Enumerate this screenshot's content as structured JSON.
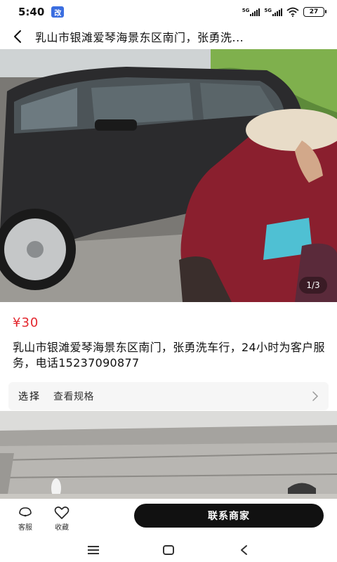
{
  "status_bar": {
    "time": "5:40",
    "app_icon_text": "改",
    "network_1": "5G",
    "network_2": "5G",
    "battery": "27"
  },
  "header": {
    "title": "乳山市银滩爱琴海景东区南门，张勇洗..."
  },
  "gallery": {
    "counter": "1/3"
  },
  "product": {
    "price": "¥30",
    "description": "乳山市银滩爱琴海景东区南门，张勇洗车行，24小时为客户服务，电话15237090877"
  },
  "spec": {
    "label": "选择",
    "value": "查看规格"
  },
  "bottom_bar": {
    "service_label": "客服",
    "favorite_label": "收藏",
    "contact_label": "联系商家"
  },
  "icons": {
    "back": "chevron-left-icon",
    "spec_chevron": "chevron-right-icon",
    "service": "headset-icon",
    "favorite": "heart-icon",
    "nav_menu": "menu-icon",
    "nav_home": "square-icon",
    "nav_back": "triangle-back-icon"
  },
  "colors": {
    "price": "#e3272e",
    "contact_button": "#111111",
    "spec_background": "#f6f6f6"
  }
}
